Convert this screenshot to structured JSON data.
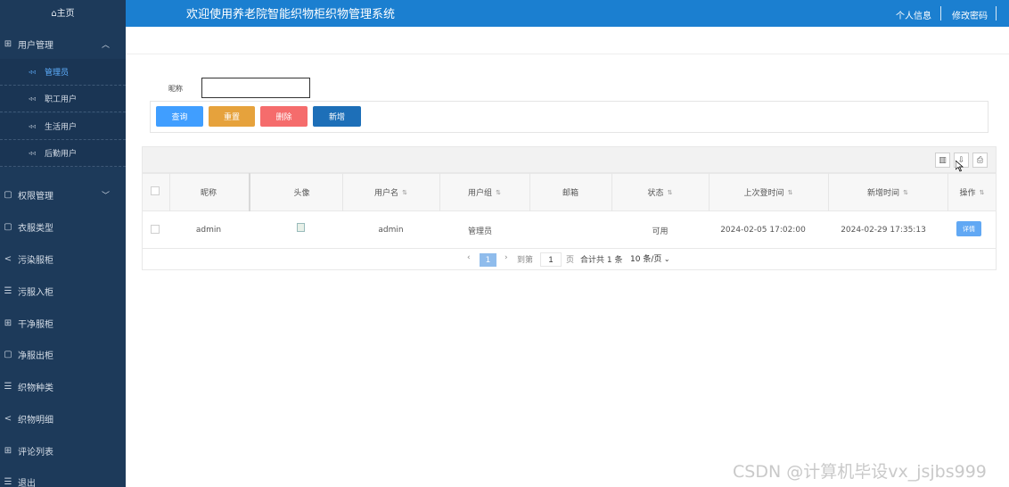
{
  "sidebar": {
    "home": "⌂主页",
    "menus": [
      {
        "label": "用户管理",
        "icon": "grid-icon",
        "glyph": "⊞",
        "expanded": true
      },
      {
        "label": "权限管理",
        "icon": "doc-icon",
        "glyph": "▢",
        "expanded": false
      },
      {
        "label": "衣服类型",
        "icon": "doc-icon",
        "glyph": "▢"
      },
      {
        "label": "污染服柜",
        "icon": "share-icon",
        "glyph": "<"
      },
      {
        "label": "污服入柜",
        "icon": "list-icon",
        "glyph": "☰"
      },
      {
        "label": "干净服柜",
        "icon": "grid-icon",
        "glyph": "⊞"
      },
      {
        "label": "净服出柜",
        "icon": "doc-icon",
        "glyph": "▢"
      },
      {
        "label": "织物种类",
        "icon": "list-icon",
        "glyph": "☰"
      },
      {
        "label": "织物明细",
        "icon": "share-icon",
        "glyph": "<"
      },
      {
        "label": "评论列表",
        "icon": "grid-icon",
        "glyph": "⊞"
      },
      {
        "label": "退出",
        "icon": "list-icon",
        "glyph": "☰"
      }
    ],
    "user_sub": [
      "管理员",
      "职工用户",
      "生活用户",
      "后勤用户"
    ],
    "active_sub": "管理员"
  },
  "header": {
    "title": "欢迎使用养老院智能织物柜织物管理系统",
    "profile": "个人信息",
    "change_password": "修改密码"
  },
  "search": {
    "label": "昵称",
    "value": "",
    "buttons": {
      "query": "查询",
      "reset": "重置",
      "delete": "删除",
      "add": "新增"
    },
    "colors": {
      "query": "#409eff",
      "reset": "#e6a23c",
      "delete": "#f56c6c",
      "add": "#1d6fb8"
    }
  },
  "table": {
    "columns": [
      "昵称",
      "头像",
      "用户名",
      "用户组",
      "邮箱",
      "状态",
      "上次登时间",
      "新增时间",
      "操作"
    ],
    "sortable": [
      false,
      false,
      true,
      true,
      false,
      true,
      true,
      true,
      true
    ],
    "rows": [
      {
        "nickname": "admin",
        "avatar": "",
        "username": "admin",
        "group": "管理员",
        "email": "",
        "status": "可用",
        "last_login": "2024-02-05 17:02:00",
        "created": "2024-02-29 17:35:13",
        "action": "详情"
      }
    ],
    "tool_icons": [
      "columns-icon",
      "export-icon",
      "print-icon"
    ]
  },
  "pagination": {
    "prev": "‹",
    "current": "1",
    "next": "›",
    "goto_label": "到第",
    "goto_value": "1",
    "page_label": "页",
    "total": "合计共 1 条",
    "page_size": "10 条/页"
  },
  "watermark": "CSDN @计算机毕设vx_jsjbs999"
}
